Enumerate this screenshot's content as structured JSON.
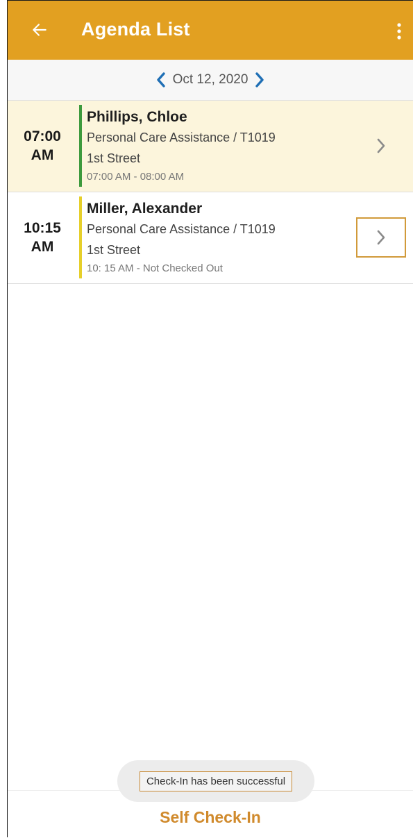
{
  "app_bar": {
    "title": "Agenda List",
    "back_icon": "arrow-left-icon",
    "menu_icon": "more-vertical-icon",
    "color": "#e2a021"
  },
  "date_nav": {
    "date": "Oct 12, 2020",
    "prev_icon": "chevron-left-icon",
    "next_icon": "chevron-right-icon",
    "arrow_color": "#1f6fb5"
  },
  "visits": [
    {
      "time": "07:00",
      "meridiem": "AM",
      "client": "Phillips, Chloe",
      "service": "Personal Care Assistance / T1019",
      "address": "1st Street",
      "time_range": "07:00 AM - 08:00 AM",
      "status_color": "#3d9a3d",
      "background": "#fcf5dc"
    },
    {
      "time": "10:15",
      "meridiem": "AM",
      "client": "Miller, Alexander",
      "service": "Personal Care Assistance / T1019",
      "address": "1st Street",
      "time_range": "10: 15 AM - Not Checked Out",
      "status_color": "#e6cf2a",
      "background": "#ffffff"
    }
  ],
  "toast": {
    "message": "Check-In has been successful"
  },
  "bottom": {
    "action_label": "Self Check-In",
    "color": "#d08a2c"
  }
}
